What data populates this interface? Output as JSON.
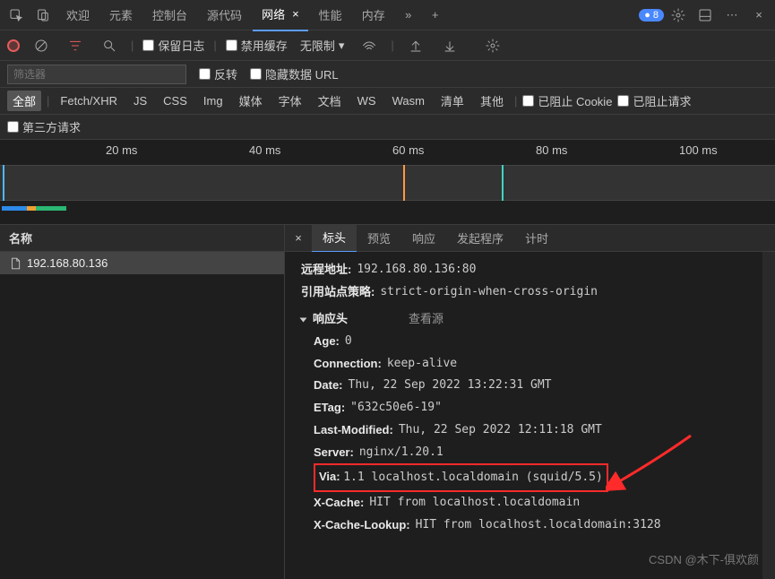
{
  "tabs": {
    "welcome": "欢迎",
    "elements": "元素",
    "console": "控制台",
    "sources": "源代码",
    "network": "网络",
    "performance": "性能",
    "memory": "内存"
  },
  "badge_count": "8",
  "toolbar": {
    "preserve_log": "保留日志",
    "disable_cache": "禁用缓存",
    "throttling": "无限制"
  },
  "filter": {
    "placeholder": "筛选器",
    "invert": "反转",
    "hide_data_urls": "隐藏数据 URL"
  },
  "types": {
    "all": "全部",
    "fetch": "Fetch/XHR",
    "js": "JS",
    "css": "CSS",
    "img": "Img",
    "media": "媒体",
    "font": "字体",
    "doc": "文档",
    "ws": "WS",
    "wasm": "Wasm",
    "manifest": "清单",
    "other": "其他",
    "blocked_cookies": "已阻止 Cookie",
    "blocked_requests": "已阻止请求"
  },
  "extra": {
    "third_party": "第三方请求"
  },
  "timeline": {
    "ticks": [
      "20 ms",
      "40 ms",
      "60 ms",
      "80 ms",
      "100 ms"
    ]
  },
  "left": {
    "header": "名称",
    "request": "192.168.80.136"
  },
  "detail_tabs": {
    "headers": "标头",
    "preview": "预览",
    "response": "响应",
    "initiator": "发起程序",
    "timing": "计时"
  },
  "headers": {
    "remote_address_k": "远程地址:",
    "remote_address_v": "192.168.80.136:80",
    "referrer_policy_k": "引用站点策略:",
    "referrer_policy_v": "strict-origin-when-cross-origin",
    "response_section": "响应头",
    "view_source": "查看源",
    "age_k": "Age:",
    "age_v": "0",
    "connection_k": "Connection:",
    "connection_v": "keep-alive",
    "date_k": "Date:",
    "date_v": "Thu, 22 Sep 2022 13:22:31 GMT",
    "etag_k": "ETag:",
    "etag_v": "\"632c50e6-19\"",
    "lastmod_k": "Last-Modified:",
    "lastmod_v": "Thu, 22 Sep 2022 12:11:18 GMT",
    "server_k": "Server:",
    "server_v": "nginx/1.20.1",
    "via_k": "Via:",
    "via_v": "1.1 localhost.localdomain (squid/5.5)",
    "xcache_k": "X-Cache:",
    "xcache_v": "HIT from localhost.localdomain",
    "xcachelookup_k": "X-Cache-Lookup:",
    "xcachelookup_v": "HIT from localhost.localdomain:3128"
  },
  "watermark": "CSDN @木下-俱欢颜"
}
